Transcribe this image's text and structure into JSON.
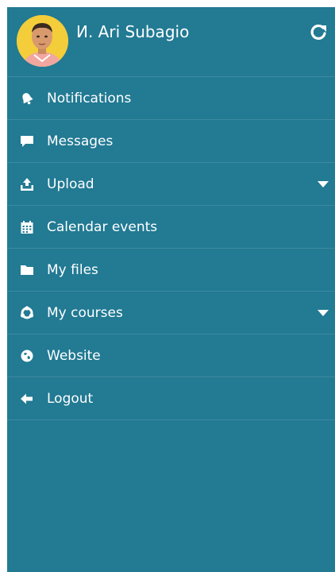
{
  "user": {
    "name": "И. Ari Subagio"
  },
  "menu": [
    {
      "label": "Notifications",
      "icon": "bell-icon",
      "expandable": false
    },
    {
      "label": "Messages",
      "icon": "chat-bubble-icon",
      "expandable": false
    },
    {
      "label": "Upload",
      "icon": "upload-icon",
      "expandable": true
    },
    {
      "label": "Calendar events",
      "icon": "calendar-icon",
      "expandable": false
    },
    {
      "label": "My files",
      "icon": "folder-icon",
      "expandable": false
    },
    {
      "label": "My courses",
      "icon": "courses-icon",
      "expandable": true
    },
    {
      "label": "Website",
      "icon": "globe-icon",
      "expandable": false
    },
    {
      "label": "Logout",
      "icon": "arrow-left-icon",
      "expandable": false
    }
  ],
  "colors": {
    "drawer_background": "#227a93",
    "text": "#ffffff",
    "avatar_background": "#f3cd3a"
  }
}
